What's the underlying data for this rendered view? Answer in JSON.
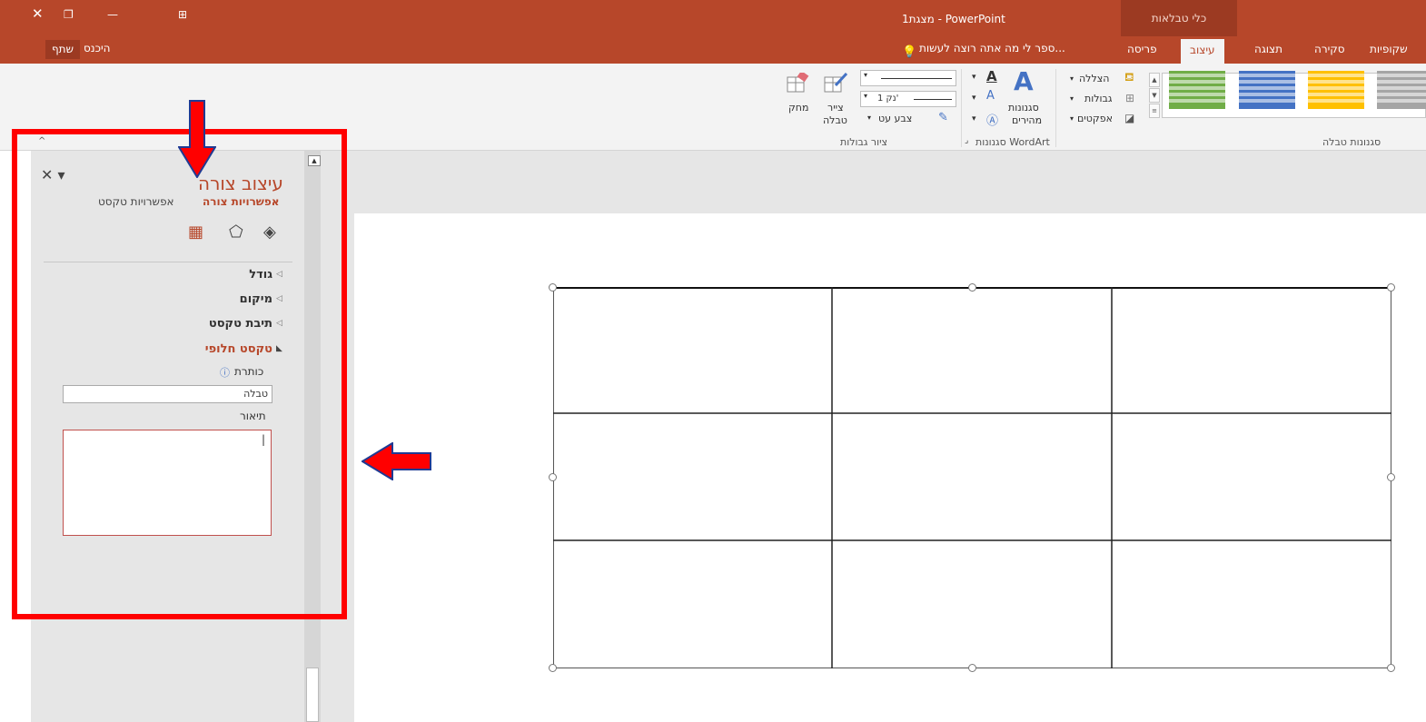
{
  "window": {
    "title": "מצגת1 - PowerPoint",
    "contextual_tab": "כלי טבלאות",
    "controls": {
      "close": "✕",
      "restore": "❐",
      "minimize": "—",
      "ribbon_options": "⊞"
    }
  },
  "tabs": [
    {
      "label": "עיצוב",
      "active": true
    },
    {
      "label": "פריסה",
      "active": false
    },
    {
      "label": "תצוגה",
      "active": false
    },
    {
      "label": "סקירה",
      "active": false
    },
    {
      "label": "שקופיות",
      "active": false
    }
  ],
  "tell_me": "ספר לי מה אתה רוצה לעשות...",
  "account": {
    "sign_in": "היכנס",
    "share": "שתף"
  },
  "ribbon": {
    "table_styles_label": "סגנונות טבלה",
    "shading": "הצללה",
    "borders": "גבולות",
    "effects": "אפקטים",
    "quick_styles": "סגנונות",
    "quick_styles_2": "מהירים",
    "wordart_label": "סגנונות WordArt",
    "pen_weight": "1 נק'",
    "pen_color": "צבע עט",
    "draw_table": "צייר",
    "draw_table_2": "טבלה",
    "eraser": "מחק",
    "draw_borders_label": "ציור גבולות",
    "swatch_colors": [
      "#70ad47",
      "#4472c4",
      "#ffc000",
      "#a5a5a5"
    ]
  },
  "pane": {
    "title": "עיצוב צורה",
    "tab_shape": "אפשרויות צורה",
    "tab_text": "אפשרויות טקסט",
    "sections": [
      {
        "label": "גודל",
        "expanded": false
      },
      {
        "label": "מיקום",
        "expanded": false
      },
      {
        "label": "תיבת טקסט",
        "expanded": false
      },
      {
        "label": "טקסט חלופי",
        "expanded": true
      }
    ],
    "title_field_label": "כותרת",
    "title_field_value": "טבלה",
    "description_label": "תיאור",
    "description_value": "|"
  },
  "table": {
    "rows": 3,
    "cols": 3
  }
}
